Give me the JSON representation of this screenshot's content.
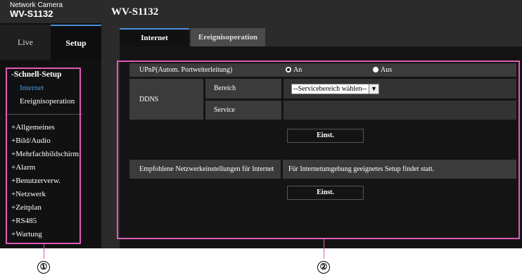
{
  "header": {
    "brand_line1": "Network Camera",
    "brand_line2": "WV-S1132",
    "title": "WV-S1132"
  },
  "tabs": {
    "live": "Live",
    "setup": "Setup"
  },
  "sidebar": {
    "heading": "-Schnell-Setup",
    "sub_items": [
      {
        "label": "Internet",
        "active": true
      },
      {
        "label": "Ereignisoperation",
        "active": false
      }
    ],
    "items": [
      "+Allgemeines",
      "+Bild/Audio",
      "+Mehrfachbildschirm",
      "+Alarm",
      "+Benutzerverw.",
      "+Netzwerk",
      "+Zeitplan",
      "+RS485",
      "+Wartung"
    ]
  },
  "content_tabs": {
    "internet": "Internet",
    "ereignis": "Ereignisoperation"
  },
  "settings": {
    "upnp_label": "UPnP(Autom. Portweiterleitung)",
    "upnp_on": "An",
    "upnp_off": "Aus",
    "upnp_selected": "An",
    "ddns_label": "DDNS",
    "bereich_label": "Bereich",
    "bereich_value": "--Servicebereich wählen--",
    "service_label": "Service",
    "einst_button": "Einst.",
    "recommended_label": "Empfohlene Netzwerkeinstellungen für Internet",
    "recommended_value": "Für Internetumgebung geeignetes Setup findet statt.",
    "einst_button2": "Einst."
  },
  "callouts": {
    "one": "①",
    "two": "②"
  },
  "colors": {
    "highlight": "#e05bb8",
    "accent": "#4a8fd8",
    "active_link": "#4a9de8"
  }
}
